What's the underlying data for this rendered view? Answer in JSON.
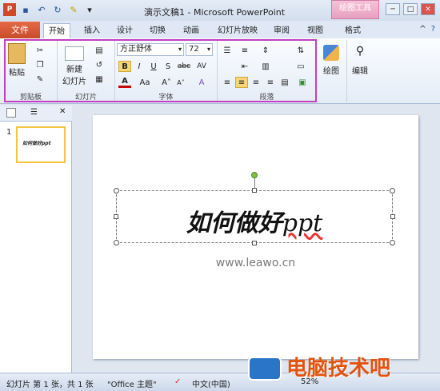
{
  "title_bar": {
    "window_title": "演示文稿1 - Microsoft PowerPoint",
    "context_tab_header": "绘图工具",
    "window_buttons": [
      "─",
      "□",
      "✕"
    ]
  },
  "qat": {
    "icons": [
      "ppt-logo",
      "save",
      "undo",
      "redo",
      "format-painter",
      "customize"
    ]
  },
  "tabs": {
    "file": "文件",
    "items": [
      "开始",
      "插入",
      "设计",
      "切换",
      "动画",
      "幻灯片放映",
      "审阅",
      "视图",
      "格式"
    ]
  },
  "ribbon": {
    "clipboard": {
      "label": "剪贴板",
      "paste": "粘贴"
    },
    "slides": {
      "label": "幻灯片",
      "new_slide_1": "新建",
      "new_slide_2": "幻灯片"
    },
    "font": {
      "label": "字体",
      "font_name": "方正舒体",
      "font_size": "72",
      "bold": "B",
      "italic": "I",
      "underline": "U",
      "shadow": "S",
      "strike": "abc",
      "spacing": "AV",
      "color": "A",
      "case": "Aa",
      "grow": "A˄",
      "shrink": "A˅",
      "clear": "A"
    },
    "paragraph": {
      "label": "段落"
    },
    "drawing": {
      "label": "绘图"
    },
    "editing": {
      "label": "编辑"
    }
  },
  "panel": {
    "slide_number": "1",
    "thumb_text": "如何做好ppt"
  },
  "slide": {
    "title_text": "如何做好",
    "title_suffix": "ppt",
    "subtitle": "www.leawo.cn"
  },
  "status": {
    "slide_info": "幻灯片 第 1 张，共 1 张",
    "theme": "\"Office 主题\"",
    "language": "中文(中国)",
    "zoom": "52%"
  },
  "watermark": {
    "text": "电脑技术吧"
  },
  "colors": {
    "file_tab": "#c84b2a",
    "highlight_frame": "#c43ec4",
    "rotate_handle": "#7cc242"
  }
}
